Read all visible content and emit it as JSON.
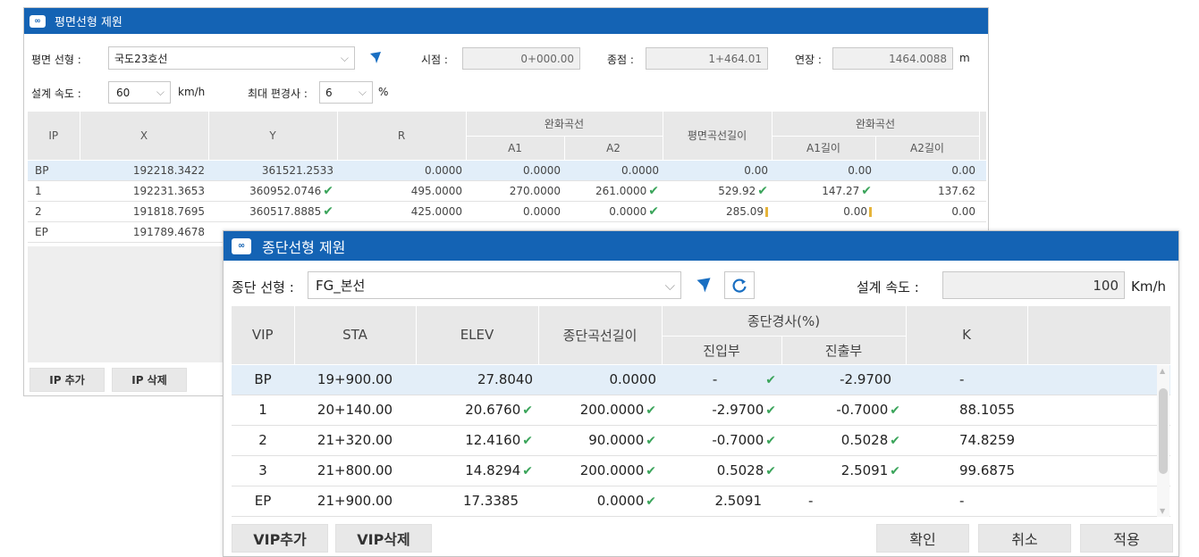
{
  "plan": {
    "title": "평면선형 제원",
    "line_label": "평면 선형 :",
    "line_value": "국도23호선",
    "start_label": "시점 :",
    "start_value": "0+000.00",
    "end_label": "종점 :",
    "end_value": "1+464.01",
    "length_label": "연장 :",
    "length_value": "1464.0088",
    "length_unit": "m",
    "speed_label": "설계 속도 :",
    "speed_value": "60",
    "speed_unit": "km/h",
    "superelev_label": "최대 편경사 :",
    "superelev_value": "6",
    "superelev_unit": "%",
    "headers": {
      "ip": "IP",
      "x": "X",
      "y": "Y",
      "r": "R",
      "transition": "완화곡선",
      "a1": "A1",
      "a2": "A2",
      "curve_length": "평면곡선길이",
      "transition2": "완화곡선",
      "a1_len": "A1길이",
      "a2_len": "A2길이"
    },
    "rows": [
      {
        "ip": "BP",
        "x": "192218.3422",
        "y": "361521.2533",
        "r": "0.0000",
        "a1": "0.0000",
        "a2": "0.0000",
        "len": "0.00",
        "a1l": "0.00",
        "a2l": "0.00"
      },
      {
        "ip": "1",
        "x": "192231.3653",
        "y": "360952.0746",
        "r": "495.0000",
        "a1": "270.0000",
        "a2": "261.0000",
        "len": "529.92",
        "a1l": "147.27",
        "a2l": "137.62"
      },
      {
        "ip": "2",
        "x": "191818.7695",
        "y": "360517.8885",
        "r": "425.0000",
        "a1": "0.0000",
        "a2": "0.0000",
        "len": "285.09",
        "a1l": "0.00",
        "a2l": "0.00"
      },
      {
        "ip": "EP",
        "x": "191789.4678",
        "y": "",
        "r": "",
        "a1": "",
        "a2": "",
        "len": "",
        "a1l": "",
        "a2l": ""
      }
    ],
    "add_button": "IP 추가",
    "delete_button": "IP 삭제"
  },
  "profile": {
    "title": "종단선형 제원",
    "line_label": "종단 선형 :",
    "line_value": "FG_본선",
    "speed_label": "설계 속도 :",
    "speed_value": "100",
    "speed_unit": "Km/h",
    "headers": {
      "vip": "VIP",
      "sta": "STA",
      "elev": "ELEV",
      "curve_length": "종단곡선길이",
      "grade": "종단경사(%)",
      "entry": "진입부",
      "exit": "진출부",
      "k": "K"
    },
    "rows": [
      {
        "vip": "BP",
        "sta": "19+900.00",
        "elev": "27.8040",
        "len": "0.0000",
        "entry": "-",
        "exit": "-2.9700",
        "k": "-"
      },
      {
        "vip": "1",
        "sta": "20+140.00",
        "elev": "20.6760",
        "len": "200.0000",
        "entry": "-2.9700",
        "exit": "-0.7000",
        "k": "88.1055"
      },
      {
        "vip": "2",
        "sta": "21+320.00",
        "elev": "12.4160",
        "len": "90.0000",
        "entry": "-0.7000",
        "exit": "0.5028",
        "k": "74.8259"
      },
      {
        "vip": "3",
        "sta": "21+800.00",
        "elev": "14.8294",
        "len": "200.0000",
        "entry": "0.5028",
        "exit": "2.5091",
        "k": "99.6875"
      },
      {
        "vip": "EP",
        "sta": "21+900.00",
        "elev": "17.3385",
        "len": "0.0000",
        "entry": "2.5091",
        "exit": "-",
        "k": "-"
      }
    ],
    "add_button": "VIP추가",
    "delete_button": "VIP삭제",
    "ok_button": "확인",
    "cancel_button": "취소",
    "apply_button": "적용"
  },
  "icons": {
    "app": "alignment-app-icon",
    "pick": "cursor-arrow-icon",
    "refresh": "refresh-icon",
    "check": "checkmark-icon",
    "dropdown": "chevron-down-icon"
  },
  "colors": {
    "titlebar": "#1463b4",
    "selected_row": "#e2eef9",
    "check": "#3aa45a",
    "warning": "#e6b43a"
  }
}
